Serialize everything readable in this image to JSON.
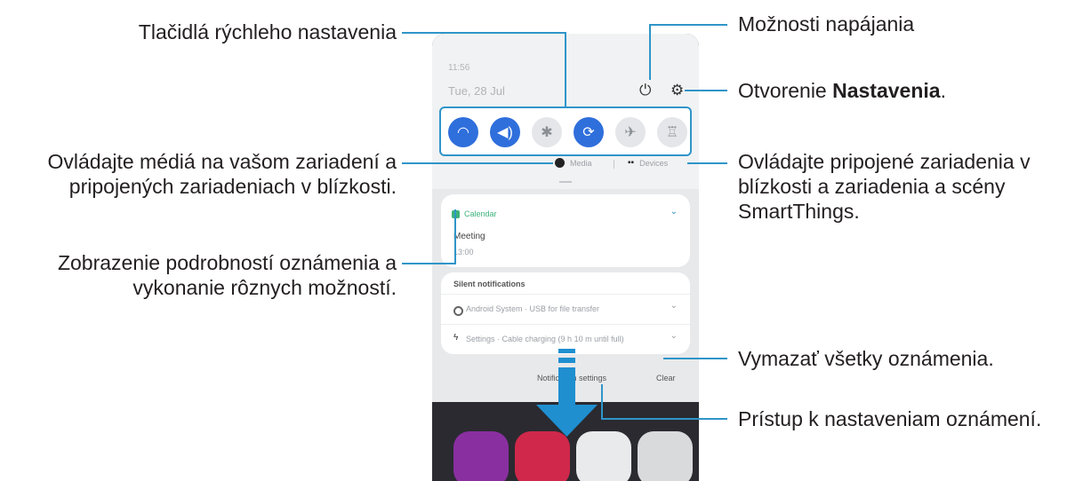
{
  "annotations": {
    "quick_settings": "Tlačidlá rýchleho nastavenia",
    "power_options": "Možnosti napájania",
    "open_settings_prefix": "Otvorenie ",
    "open_settings_bold": "Nastavenia",
    "open_settings_suffix": ".",
    "media_control_line1": "Ovládajte médiá na vašom zariadení a",
    "media_control_line2": "pripojených zariadeniach v blízkosti.",
    "devices_control_line1": "Ovládajte pripojené zariadenia v",
    "devices_control_line2": "blízkosti a zariadenia a scény",
    "devices_control_line3": "SmartThings.",
    "notification_details_line1": "Zobrazenie podrobností oznámenia a",
    "notification_details_line2": "vykonanie rôznych možností.",
    "clear_all": "Vymazať všetky oznámenia.",
    "notification_settings_access": "Prístup k nastaveniam oznámení."
  },
  "phone": {
    "time": "11:56",
    "date": "Tue, 28 Jul",
    "media_label": "Media",
    "devices_label": "Devices",
    "notification": {
      "app": "Calendar",
      "title": "Meeting",
      "subtitle": "13:00"
    },
    "silent_header": "Silent notifications",
    "silent_items": [
      "Android System · USB for file transfer",
      "Settings · Cable charging (9 h 10 m until full)"
    ],
    "notification_settings_button": "Notification settings",
    "clear_button": "Clear"
  },
  "colors": {
    "accent_line": "#2f95c9",
    "quick_toggle_on": "#2f6fdc",
    "arrow": "#1f8fd0"
  }
}
